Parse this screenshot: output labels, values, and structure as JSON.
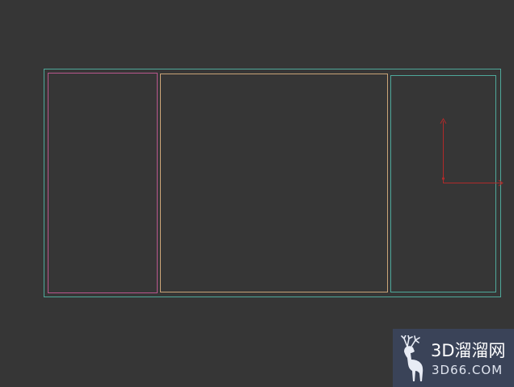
{
  "canvas": {
    "background": "#363636"
  },
  "shapes": {
    "outer_frame": {
      "color": "#4fa89a"
    },
    "left_panel": {
      "color": "#b8578d"
    },
    "center_panel": {
      "color": "#c9a377"
    },
    "right_panel": {
      "color": "#4fa89a"
    }
  },
  "gizmo": {
    "color": "#b02a2a",
    "icon": "xy-axis-gizmo"
  },
  "watermark": {
    "title": "3D溜溜网",
    "subtitle": "3D66.COM",
    "icon": "deer-logo-icon",
    "background": "#3a4358"
  }
}
